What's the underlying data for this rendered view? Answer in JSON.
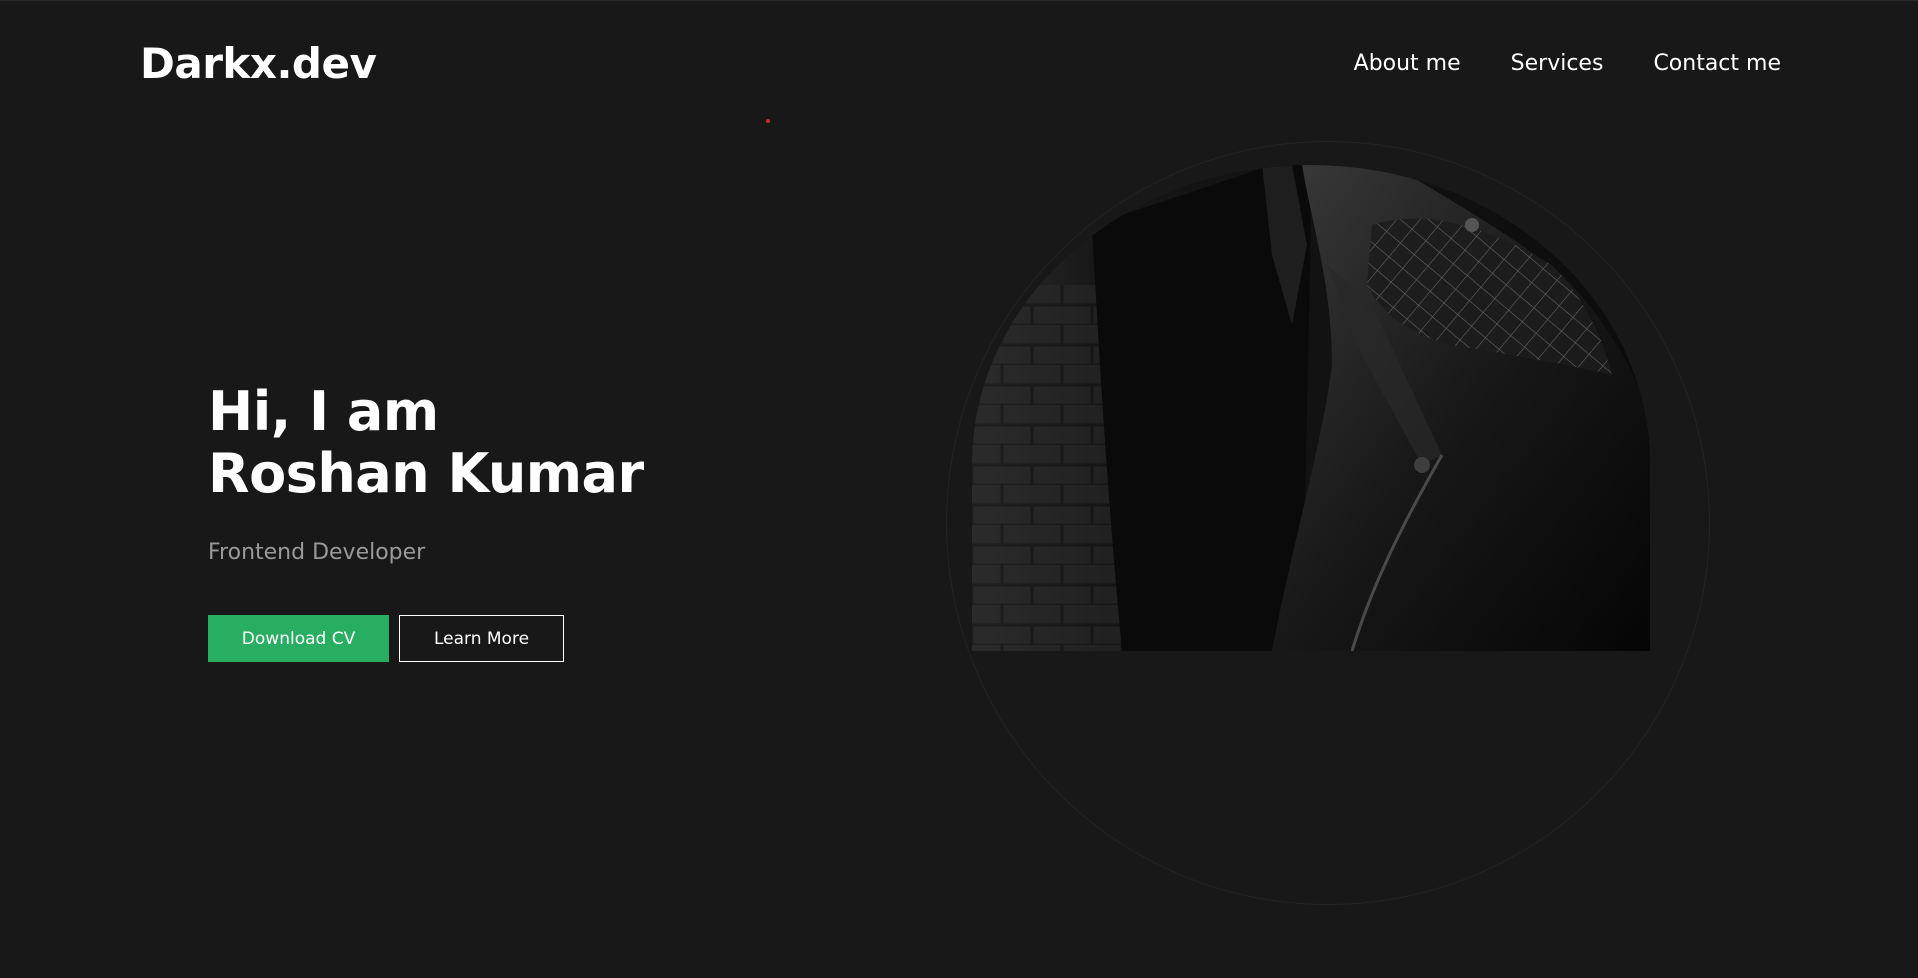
{
  "header": {
    "logo": "Darkx.dev",
    "nav": [
      {
        "label": "About me"
      },
      {
        "label": "Services"
      },
      {
        "label": "Contact me"
      }
    ]
  },
  "hero": {
    "greeting": "Hi, I am",
    "name": "Roshan Kumar",
    "role": "Frontend Developer",
    "primary_button": "Download CV",
    "secondary_button": "Learn More"
  },
  "colors": {
    "background": "#181818",
    "accent": "#27ae60",
    "subtitle": "#9a9a9a"
  }
}
